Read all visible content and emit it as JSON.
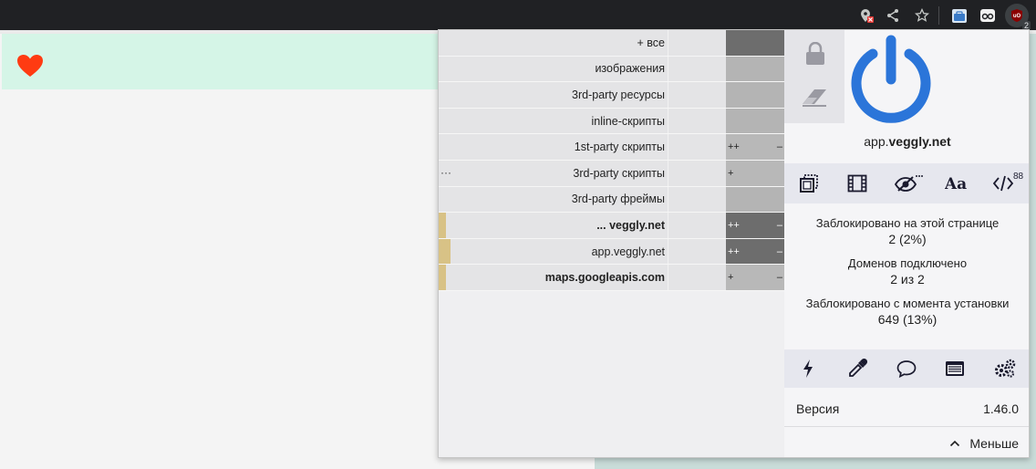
{
  "browser": {
    "toolbar_icons": [
      "location-blocked-icon",
      "share-icon",
      "bookmark-star-icon",
      "extension-briefcase-icon",
      "extension-mask-icon",
      "ublock-origin-icon"
    ],
    "ubo_badge": "2"
  },
  "page": {
    "header_icon": "heart-icon",
    "header_bg": "#d5f5e7",
    "heart_color": "#ff3b12"
  },
  "firewall": {
    "rows": [
      {
        "label": "+ все",
        "bold": false,
        "ellipsis": "",
        "bar": 0,
        "cell": "dark",
        "left": "",
        "right": ""
      },
      {
        "label": "изображения",
        "bold": false,
        "ellipsis": "",
        "bar": 0,
        "cell": "mid",
        "left": "",
        "right": ""
      },
      {
        "label": "3rd-party ресурсы",
        "bold": false,
        "ellipsis": "",
        "bar": 0,
        "cell": "mid",
        "left": "",
        "right": ""
      },
      {
        "label": "inline-скрипты",
        "bold": false,
        "ellipsis": "",
        "bar": 0,
        "cell": "mid",
        "left": "",
        "right": ""
      },
      {
        "label": "1st-party скрипты",
        "bold": false,
        "ellipsis": "",
        "bar": 0,
        "cell": "light",
        "left": "++",
        "right": "–"
      },
      {
        "label": "3rd-party скрипты",
        "bold": false,
        "ellipsis": "···",
        "bar": 0,
        "cell": "light",
        "left": "+",
        "right": ""
      },
      {
        "label": "3rd-party фреймы",
        "bold": false,
        "ellipsis": "",
        "bar": 0,
        "cell": "mid",
        "left": "",
        "right": ""
      },
      {
        "label": "... veggly.net",
        "bold": true,
        "ellipsis": "",
        "bar": 0.03,
        "cell": "dark",
        "left": "++",
        "right": "–"
      },
      {
        "label": "app.veggly.net",
        "bold": false,
        "ellipsis": "",
        "bar": 0.05,
        "cell": "dark",
        "left": "++",
        "right": "–"
      },
      {
        "label": "maps.googleapis.com",
        "bold": true,
        "ellipsis": "",
        "bar": 0.03,
        "cell": "light",
        "left": "+",
        "right": "–"
      }
    ]
  },
  "panel": {
    "hostname_sub": "app.",
    "hostname_domain": "veggly.net",
    "power_color": "#2b75d9",
    "quick_icons": [
      "popup-block-icon",
      "media-block-icon",
      "cosmetic-filter-icon",
      "remote-font-icon",
      "javascript-icon"
    ],
    "js_count": "88",
    "blocked_page_label": "Заблокировано на этой странице",
    "blocked_page_value": "2 (2%)",
    "domains_label": "Доменов подключено",
    "domains_value": "2 из 2",
    "blocked_total_label": "Заблокировано с момента установки",
    "blocked_total_value": "649 (13%)",
    "tool_icons": [
      "zap-icon",
      "picker-icon",
      "report-icon",
      "logger-icon",
      "dashboard-icon"
    ],
    "version_label": "Версия",
    "version_value": "1.46.0",
    "less_label": "Меньше"
  }
}
